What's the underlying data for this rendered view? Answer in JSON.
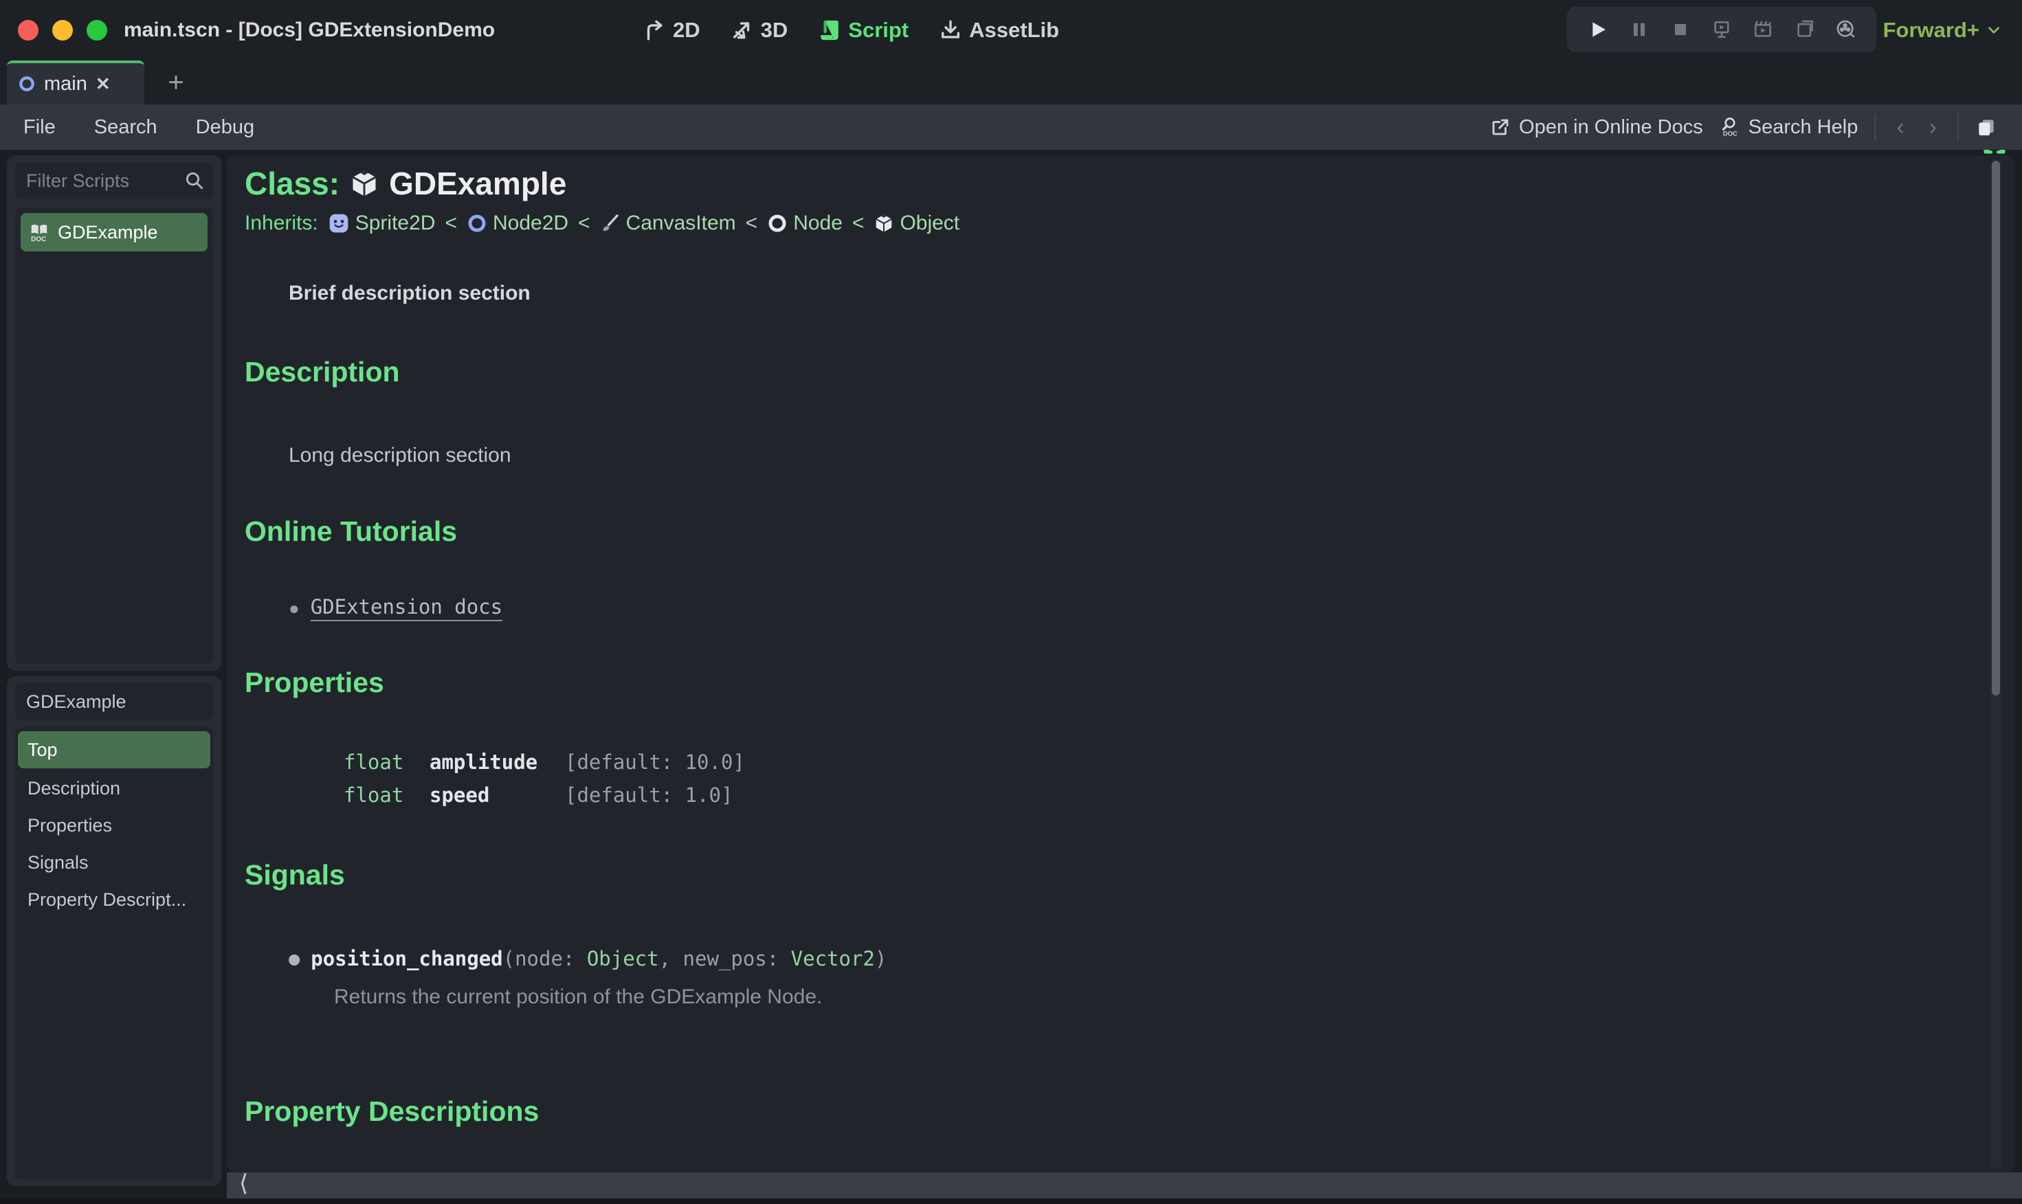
{
  "window": {
    "title": "main.tscn - [Docs] GDExtensionDemo",
    "renderer": "Forward+"
  },
  "workspaces": [
    {
      "label": "2D",
      "active": false
    },
    {
      "label": "3D",
      "active": false
    },
    {
      "label": "Script",
      "active": true
    },
    {
      "label": "AssetLib",
      "active": false
    }
  ],
  "scene_tabs": {
    "active_tab": "main",
    "close_glyph": "✕",
    "add_glyph": "+"
  },
  "menu": {
    "items": [
      "File",
      "Search",
      "Debug"
    ],
    "open_online_docs": "Open in Online Docs",
    "search_help": "Search Help",
    "back_glyph": "‹",
    "forward_glyph": "›"
  },
  "sidebar": {
    "filter_placeholder": "Filter Scripts",
    "scripts": [
      {
        "label": "GDExample",
        "selected": true
      }
    ],
    "class_box": "GDExample",
    "members": [
      {
        "label": "Top",
        "selected": true
      },
      {
        "label": "Description",
        "selected": false
      },
      {
        "label": "Properties",
        "selected": false
      },
      {
        "label": "Signals",
        "selected": false
      },
      {
        "label": "Property Descript...",
        "selected": false
      }
    ]
  },
  "doc": {
    "class_label": "Class:",
    "class_name": "GDExample",
    "inherits_label": "Inherits:",
    "inherits_chain": [
      {
        "name": "Sprite2D",
        "icon": "sprite2d-icon"
      },
      {
        "name": "Node2D",
        "icon": "node2d-icon"
      },
      {
        "name": "CanvasItem",
        "icon": "canvasitem-icon"
      },
      {
        "name": "Node",
        "icon": "node-icon"
      },
      {
        "name": "Object",
        "icon": "object-icon"
      }
    ],
    "inherits_sep": "<",
    "brief": "Brief description section",
    "description": {
      "title": "Description",
      "body": "Long description section"
    },
    "tutorials": {
      "title": "Online Tutorials",
      "bullet": "●",
      "link": "GDExtension docs"
    },
    "properties": {
      "title": "Properties",
      "rows": [
        {
          "type": "float",
          "name": "amplitude",
          "default": "[default: 10.0]"
        },
        {
          "type": "float",
          "name": "speed",
          "default": "[default: 1.0]"
        }
      ]
    },
    "signals": {
      "title": "Signals",
      "bullet": "●",
      "name": "position_changed",
      "part_open": "(node: ",
      "type1": "Object",
      "part_mid": ", new_pos: ",
      "type2": "Vector2",
      "part_close": ")",
      "description": "Returns the current position of the GDExample Node."
    },
    "property_descriptions": {
      "title": "Property Descriptions"
    }
  },
  "footer": {
    "collapse_glyph": "⟨"
  },
  "icons": {
    "doc_text": "DOC"
  },
  "colors": {
    "accent_green": "#6be48a",
    "pale_green": "#a6dcab",
    "code_green": "#93d4a0",
    "selected_green": "#47704f",
    "tab_accent": "#4fbb6b",
    "renderer_green": "#8ab757",
    "script_active": "#5ce27b",
    "traffic_red": "#f65f57",
    "traffic_yellow": "#fdbc2e",
    "traffic_green": "#29c73f",
    "doc_bg": "#21252b",
    "panel_bg": "#272b32",
    "menubar_bg": "#32363d",
    "titlebar_bg": "#1d2126"
  }
}
